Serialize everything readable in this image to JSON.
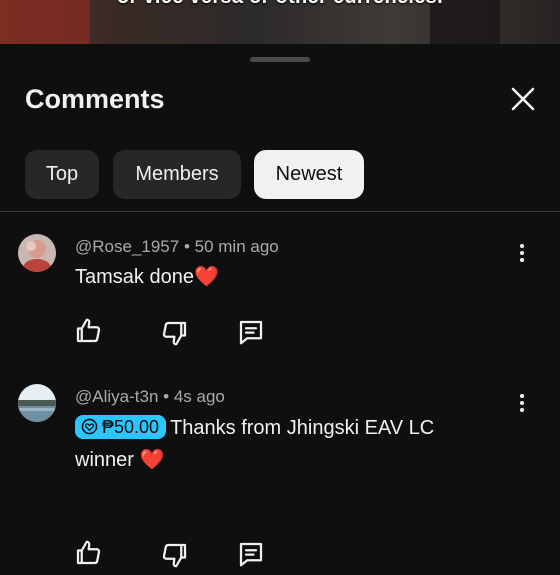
{
  "video": {
    "caption": "or vice versa or other currencies."
  },
  "panel": {
    "title": "Comments"
  },
  "filters": [
    {
      "label": "Top",
      "active": false
    },
    {
      "label": "Members",
      "active": false
    },
    {
      "label": "Newest",
      "active": true
    }
  ],
  "comments": [
    {
      "author": "@Rose_1957",
      "time": "50 min ago",
      "text": "Tamsak done",
      "emoji": "❤️"
    },
    {
      "author": "@Aliya-t3n",
      "time": "4s ago",
      "super_thanks_amount": "₱50.00",
      "text_line1": "Thanks from Jhingski EAV LC",
      "text_line2": "winner",
      "emoji": "❤️"
    }
  ],
  "separator": "•",
  "icons": [
    "close-icon",
    "more-vert-icon",
    "thumbs-up-icon",
    "thumbs-down-icon",
    "reply-icon",
    "super-thanks-icon"
  ],
  "colors": {
    "background": "#0f0f0f",
    "chip": "#272727",
    "active_chip": "#f1f1f1",
    "badge": "#2bc6ff",
    "heart": "#e0312b"
  }
}
